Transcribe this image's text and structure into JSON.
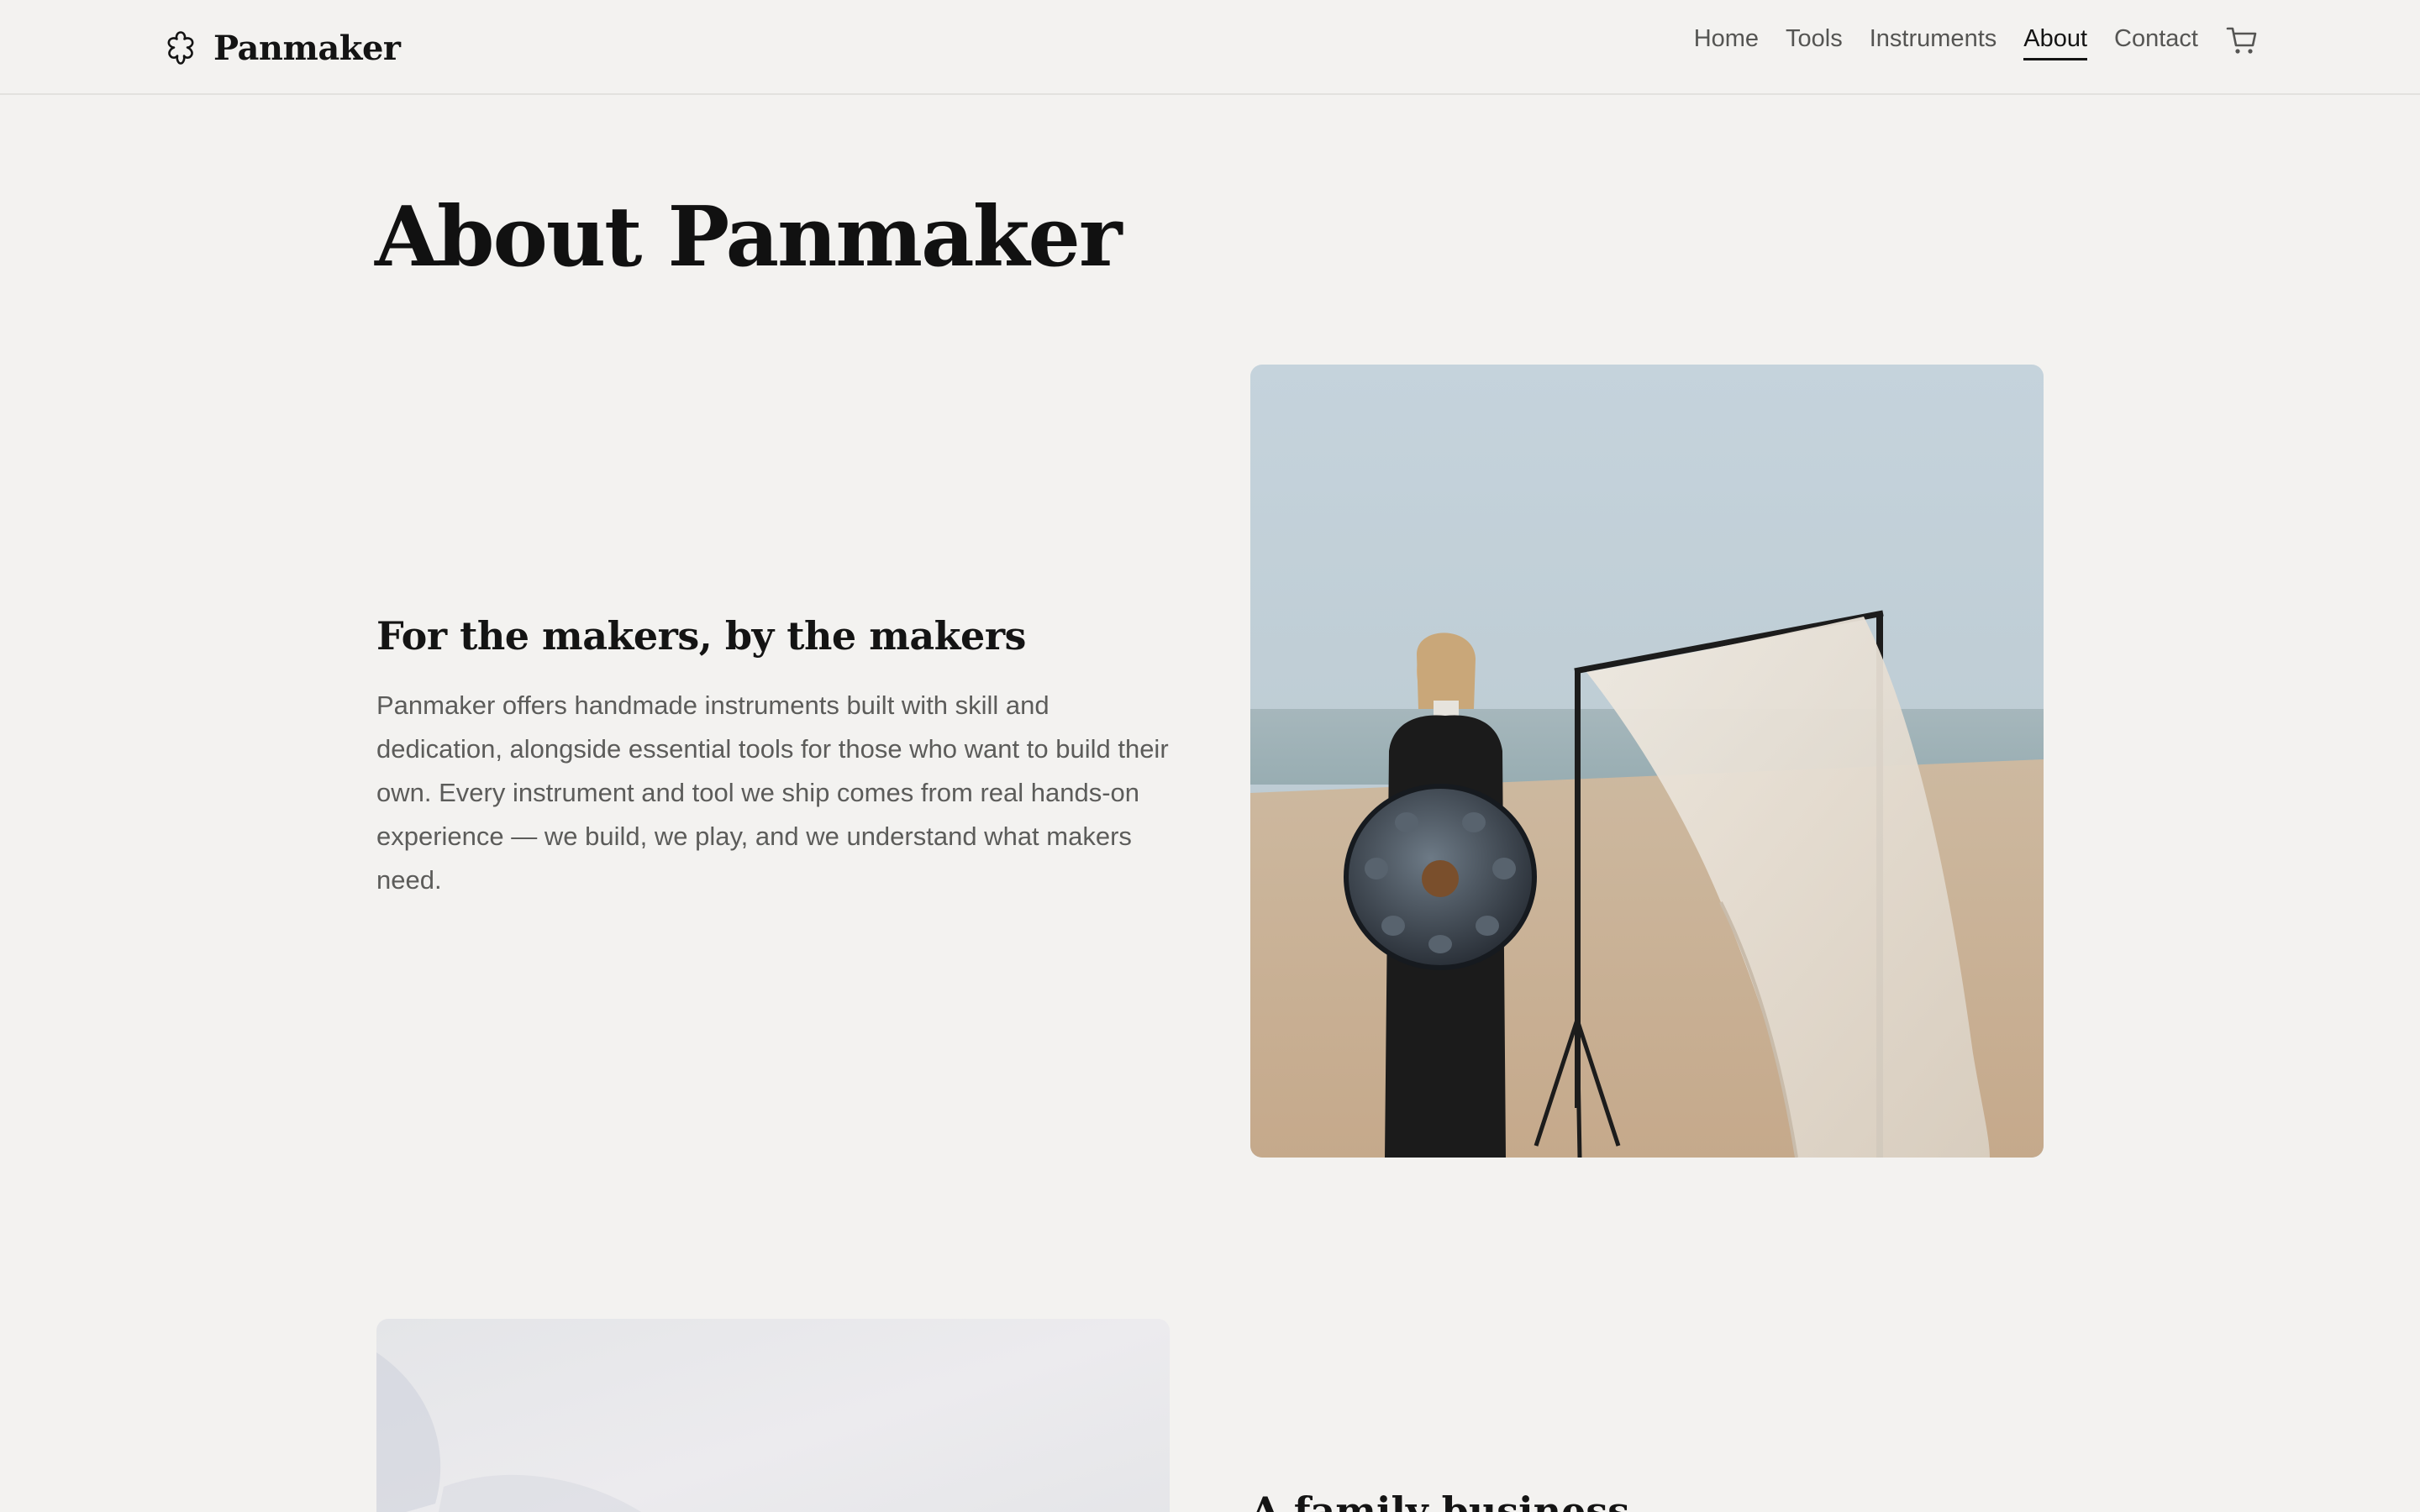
{
  "brand": {
    "name": "Panmaker",
    "logo_icon": "flower-outline-icon"
  },
  "nav": {
    "items": [
      {
        "label": "Home"
      },
      {
        "label": "Tools"
      },
      {
        "label": "Instruments"
      },
      {
        "label": "About",
        "active": true
      },
      {
        "label": "Contact"
      }
    ],
    "cart_icon": "shopping-cart-icon"
  },
  "page": {
    "title": "About Panmaker"
  },
  "section_1": {
    "heading": "For the makers, by the makers",
    "body": "Panmaker offers handmade instruments built with skill and dedication, alongside essential tools for those who want to build their own. Every instrument and tool we ship comes from real hands-on experience — we build, we play, and we understand what makers need."
  },
  "section_2": {
    "heading_partial": "A family business"
  },
  "colors": {
    "background": "#f3f2f0",
    "text": "#141414",
    "muted_text": "#5c5c5a",
    "nav_text": "#555553"
  }
}
